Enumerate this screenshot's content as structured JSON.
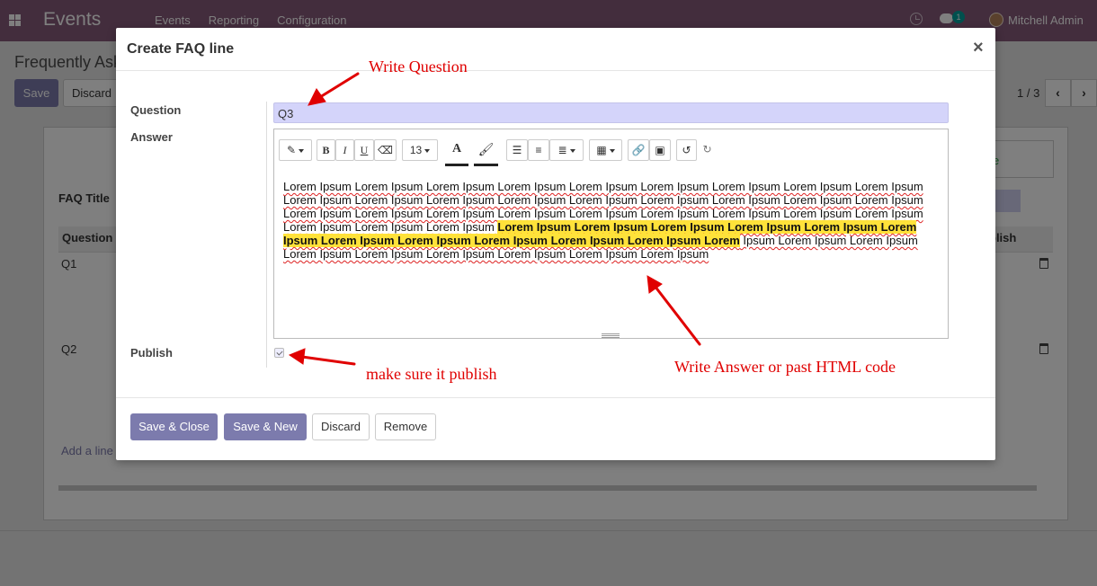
{
  "navbar": {
    "app_title": "Events",
    "menu": [
      "Events",
      "Reporting",
      "Configuration"
    ],
    "chat_count": "1",
    "user_name": "Mitchell Admin",
    "color": "#875a7b"
  },
  "background": {
    "page_title": "Frequently Ask",
    "save_label": "Save",
    "discard_label": "Discard",
    "pager": "1 / 3",
    "faq_title_label": "FAQ Title",
    "col_question": "Question",
    "col_publish": "blish",
    "status_text": "e",
    "rows": [
      "Q1",
      "Q2"
    ],
    "add_line": "Add a line"
  },
  "modal": {
    "title": "Create FAQ line",
    "close": "×",
    "question_label": "Question",
    "question_value": "Q3",
    "answer_label": "Answer",
    "publish_label": "Publish",
    "publish_checked": true,
    "font_size": "13",
    "answer_segments": [
      {
        "text": "Lorem Ipsum Lorem Ipsum Lorem Ipsum Lorem Ipsum Lorem Ipsum Lorem Ipsum Lorem Ipsum Lorem Ipsum Lorem Ipsum Lorem Ipsum Lorem Ipsum Lorem Ipsum Lorem Ipsum Lorem Ipsum Lorem Ipsum Lorem Ipsum Lorem Ipsum Lorem Ipsum Lorem Ipsum Lorem Ipsum Lorem Ipsum Lorem Ipsum Lorem Ipsum Lorem Ipsum Lorem Ipsum Lorem Ipsum Lorem Ipsum Lorem Ipsum Lorem Ipsum Lorem Ipsum ",
        "highlight": false
      },
      {
        "text": "Lorem Ipsum Lorem Ipsum Lorem Ipsum Lorem Ipsum Lorem Ipsum Lorem Ipsum Lorem Ipsum Lorem Ipsum Lorem Ipsum Lorem Ipsum Lorem Ipsum Lorem",
        "highlight": true
      },
      {
        "text": " Ipsum Lorem Ipsum Lorem Ipsum Lorem Ipsum Lorem Ipsum Lorem Ipsum Lorem Ipsum Lorem Ipsum Lorem Ipsum",
        "highlight": false
      }
    ]
  },
  "footer": {
    "save_close": "Save & Close",
    "save_new": "Save & New",
    "discard": "Discard",
    "remove": "Remove"
  },
  "annotations": {
    "write_question": "Write Question",
    "publish_note": "make sure it publish",
    "answer_note": "Write Answer or past HTML code",
    "color": "#e00000"
  }
}
